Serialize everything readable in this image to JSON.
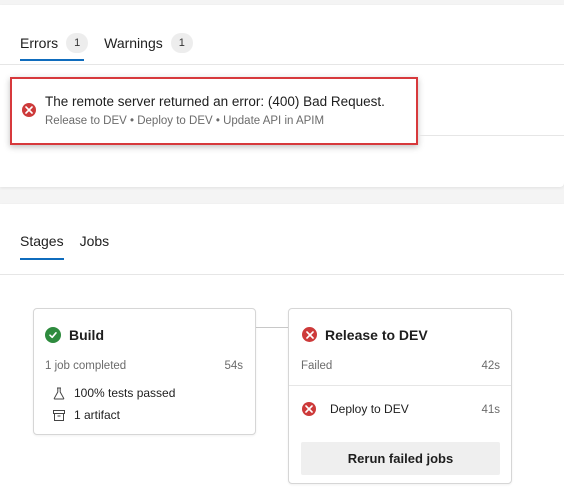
{
  "issues": {
    "tabs": [
      {
        "label": "Errors",
        "count": "1"
      },
      {
        "label": "Warnings",
        "count": "1"
      }
    ],
    "error": {
      "message": "The remote server returned an error: (400) Bad Request.",
      "path": "Release to DEV • Deploy to DEV • Update API in APIM"
    }
  },
  "stages_panel": {
    "tabs": [
      {
        "label": "Stages"
      },
      {
        "label": "Jobs"
      }
    ],
    "build": {
      "name": "Build",
      "status_text": "1 job completed",
      "duration": "54s",
      "tests": "100% tests passed",
      "artifacts": "1 artifact"
    },
    "release": {
      "name": "Release to DEV",
      "status_text": "Failed",
      "duration": "42s",
      "job_name": "Deploy to DEV",
      "job_duration": "41s",
      "rerun_label": "Rerun failed jobs"
    }
  },
  "colors": {
    "error": "#cd3a3a",
    "success": "#2e8b3e",
    "accent": "#0f6cbd",
    "highlight_border": "#d7393c"
  }
}
